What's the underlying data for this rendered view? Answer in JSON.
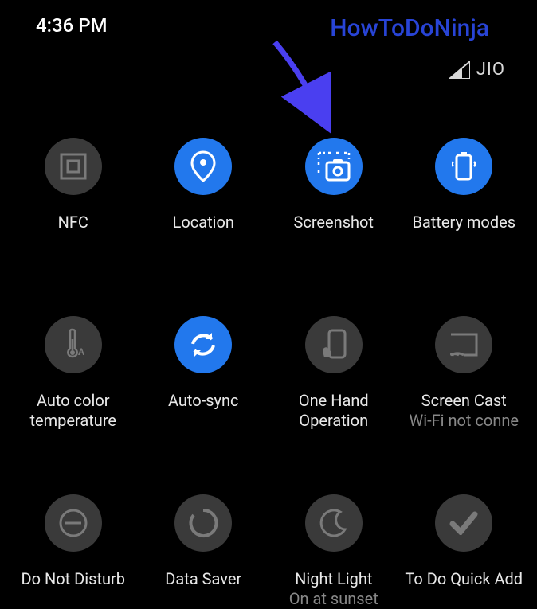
{
  "status": {
    "time": "4:36 PM",
    "carrier": "JIO"
  },
  "watermark": "HowToDoNinja",
  "tiles": [
    {
      "label": "NFC",
      "sublabel": "",
      "active": false
    },
    {
      "label": "Location",
      "sublabel": "",
      "active": true
    },
    {
      "label": "Screenshot",
      "sublabel": "",
      "active": true
    },
    {
      "label": "Battery modes",
      "sublabel": "",
      "active": true
    },
    {
      "label": "Auto color temperature",
      "sublabel": "",
      "active": false
    },
    {
      "label": "Auto-sync",
      "sublabel": "",
      "active": true
    },
    {
      "label": "One Hand Operation",
      "sublabel": "",
      "active": false
    },
    {
      "label": "Screen Cast",
      "sublabel": "Wi-Fi not conne",
      "active": false
    },
    {
      "label": "Do Not Disturb",
      "sublabel": "",
      "active": false
    },
    {
      "label": "Data Saver",
      "sublabel": "",
      "active": false
    },
    {
      "label": "Night Light",
      "sublabel": "On at sunset",
      "active": false
    },
    {
      "label": "To Do Quick Add",
      "sublabel": "",
      "active": false
    }
  ]
}
